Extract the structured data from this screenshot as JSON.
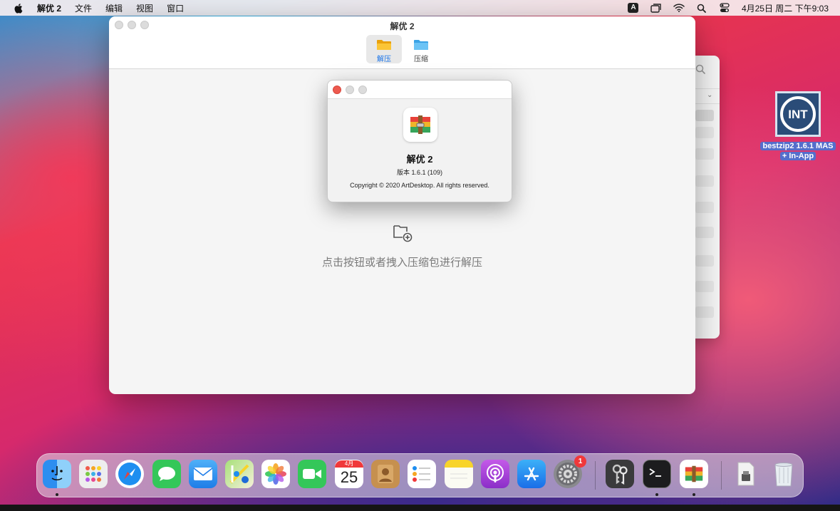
{
  "menubar": {
    "apple_icon": "apple-icon",
    "items": [
      "解优 2",
      "文件",
      "编辑",
      "视图",
      "窗口"
    ],
    "clock": "4月25日 周二 下午9:03",
    "status_icons": [
      "input-source-icon",
      "screen-mirroring-icon",
      "wifi-icon",
      "spotlight-icon",
      "control-center-icon"
    ],
    "input_source_letter": "A"
  },
  "main_window": {
    "title": "解优 2",
    "toolbar": [
      {
        "label": "解压",
        "icon": "folder-open-icon",
        "selected": true
      },
      {
        "label": "压缩",
        "icon": "folder-icon",
        "selected": false
      }
    ],
    "drop_hint": "点击按钮或者拽入压缩包进行解压"
  },
  "about_dialog": {
    "app_name": "解优 2",
    "version": "版本 1.6.1 (109)",
    "copyright": "Copyright © 2020 ArtDesktop. All rights reserved."
  },
  "desktop_icon": {
    "label_line1": "bestzip2 1.6.1 MAS",
    "label_line2": "+ In-App",
    "logo_text": "INT"
  },
  "dock": {
    "apps": [
      "Finder",
      "Launchpad",
      "Safari",
      "Messages",
      "Mail",
      "Maps",
      "Photos",
      "FaceTime",
      "Calendar",
      "Contacts",
      "Reminders",
      "Notes",
      "Podcasts",
      "App Store",
      "System Preferences",
      "Keychain Access",
      "Terminal",
      "解优 2",
      "Documents",
      "Trash"
    ],
    "calendar_month": "4月",
    "calendar_day": "25",
    "system_prefs_badge": "1"
  },
  "colors": {
    "accent_blue": "#1a73e8",
    "close_red": "#ed5a4f",
    "badge_red": "#f0383a"
  }
}
